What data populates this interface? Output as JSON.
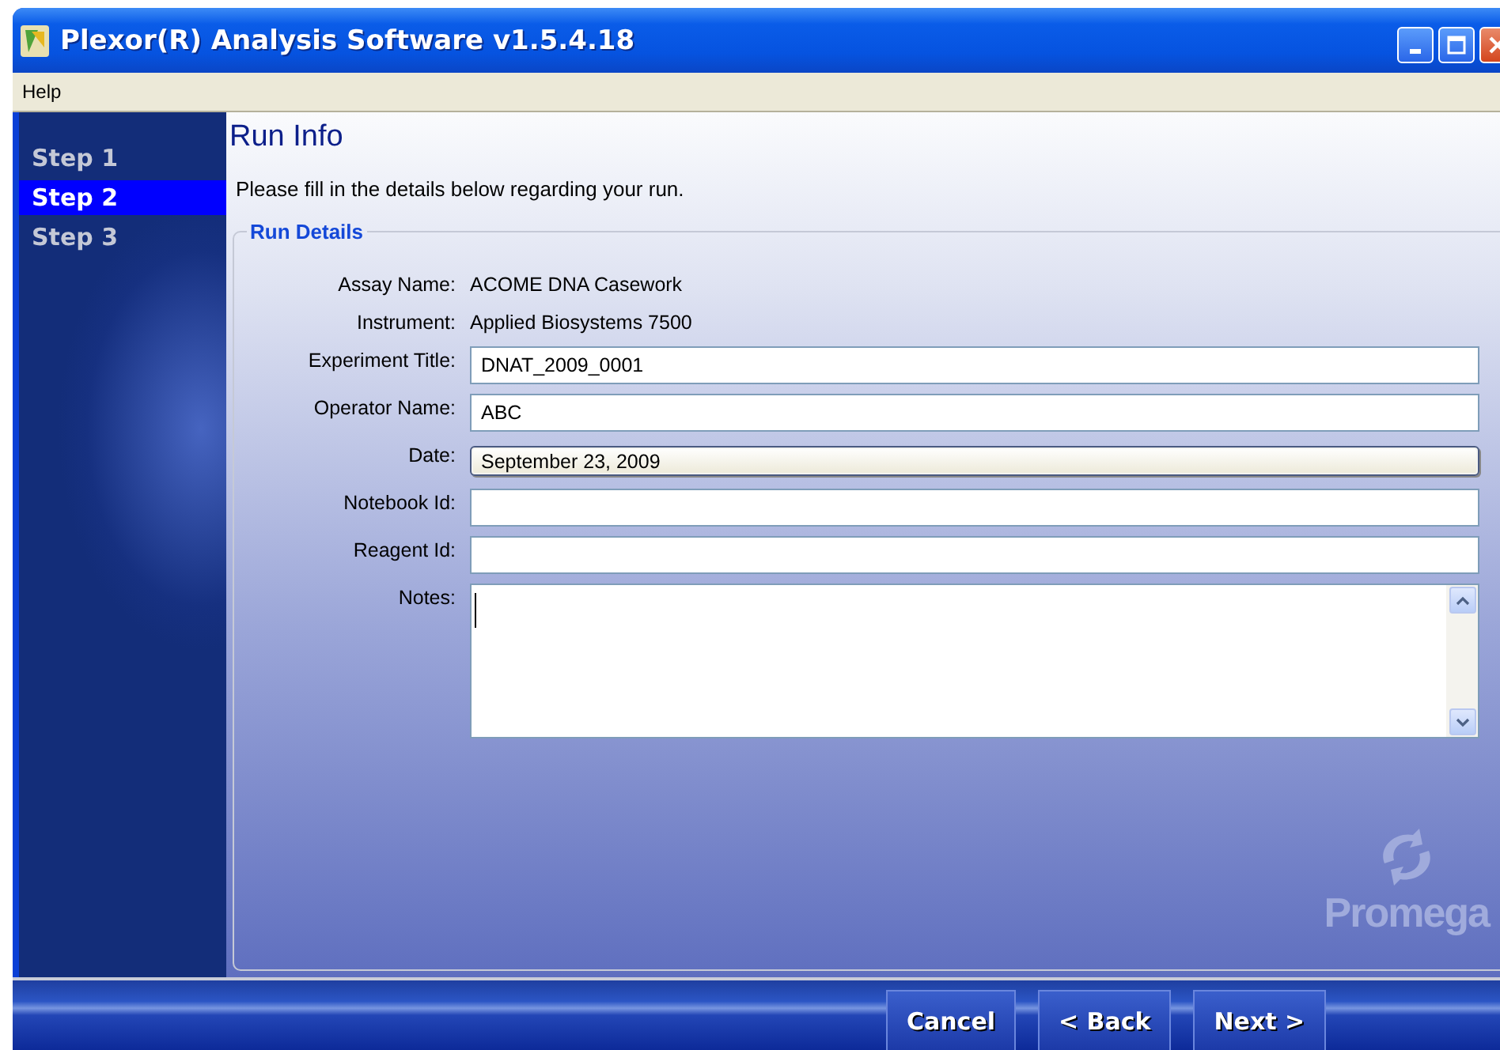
{
  "window": {
    "title": "Plexor(R) Analysis Software v1.5.4.18"
  },
  "menu": [
    "Help"
  ],
  "steps": [
    {
      "label": "Step 1",
      "selected": false
    },
    {
      "label": "Step 2",
      "selected": true
    },
    {
      "label": "Step 3",
      "selected": false
    }
  ],
  "page": {
    "heading": "Run Info",
    "instruction": "Please fill in the details below regarding your run."
  },
  "run_details": {
    "title": "Run Details",
    "fields": [
      {
        "kind": "info",
        "label": "Assay Name:",
        "value": "ACOME DNA Casework"
      },
      {
        "kind": "info",
        "label": "Instrument:",
        "value": "Applied Biosystems 7500"
      },
      {
        "kind": "text",
        "label": "Experiment Title:",
        "value": "DNAT_2009_0001"
      },
      {
        "kind": "text",
        "label": "Operator Name:",
        "value": "ABC"
      },
      {
        "kind": "date",
        "label": "Date:",
        "value": "September 23, 2009"
      },
      {
        "kind": "text",
        "label": "Notebook Id:"
      },
      {
        "kind": "text",
        "label": "Reagent Id:"
      },
      {
        "kind": "textarea",
        "label": "Notes:"
      }
    ]
  },
  "logo": {
    "text": "Promega"
  },
  "buttons": [
    "Cancel",
    "< Back",
    "Next >"
  ]
}
